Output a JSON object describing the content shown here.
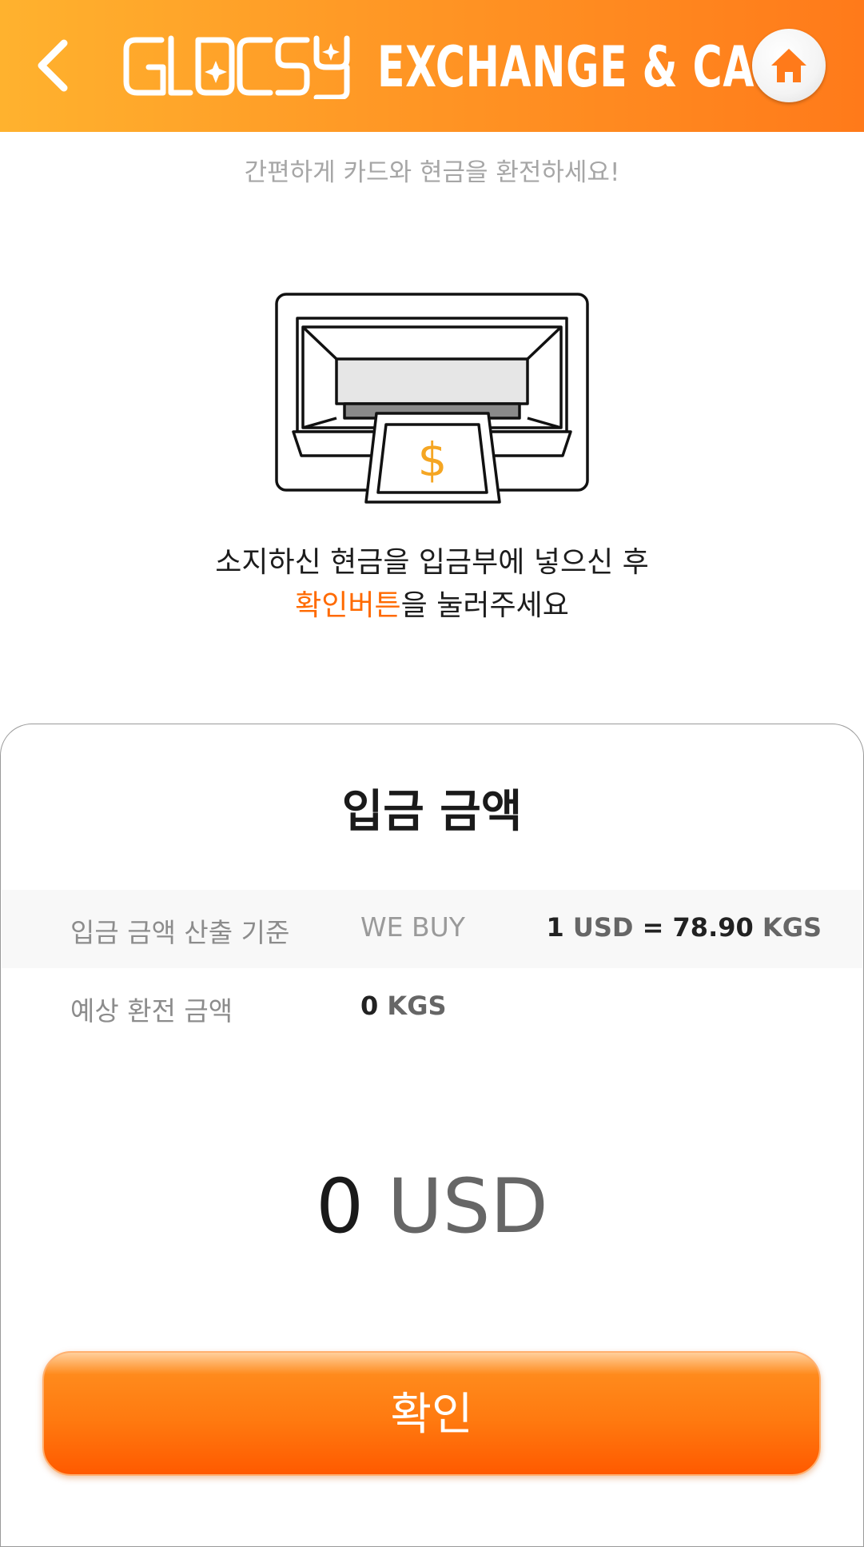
{
  "header": {
    "logo_text": "GLOCSY",
    "title": "EXCHANGE & CARD"
  },
  "subtitle": "간편하게 카드와 현금을 환전하세요!",
  "instruction": {
    "line1": "소지하신 현금을 입금부에 넣으신 후",
    "line2_accent": "확인버튼",
    "line2_rest": "을 눌러주세요"
  },
  "panel": {
    "title": "입금 금액",
    "rate_row": {
      "label": "입금 금액 산출 기준",
      "mode": "WE BUY",
      "value_prefix": "1 ",
      "value_unit1": "USD",
      "value_mid": " = 78.90 ",
      "value_unit2": "KGS"
    },
    "expected_row": {
      "label": "예상 환전 금액",
      "value_num": "0 ",
      "value_unit": "KGS"
    },
    "amount": {
      "number": "0",
      "currency": "USD"
    },
    "confirm_label": "확인"
  },
  "colors": {
    "header_gradient_start": "#ffb22e",
    "header_gradient_end": "#ff7a1a",
    "accent": "#ff6a00",
    "dollar_sign": "#f5a623"
  },
  "icons": {
    "back": "chevron-left-icon",
    "home": "home-icon",
    "illustration": "cash-deposit-slot-icon"
  }
}
